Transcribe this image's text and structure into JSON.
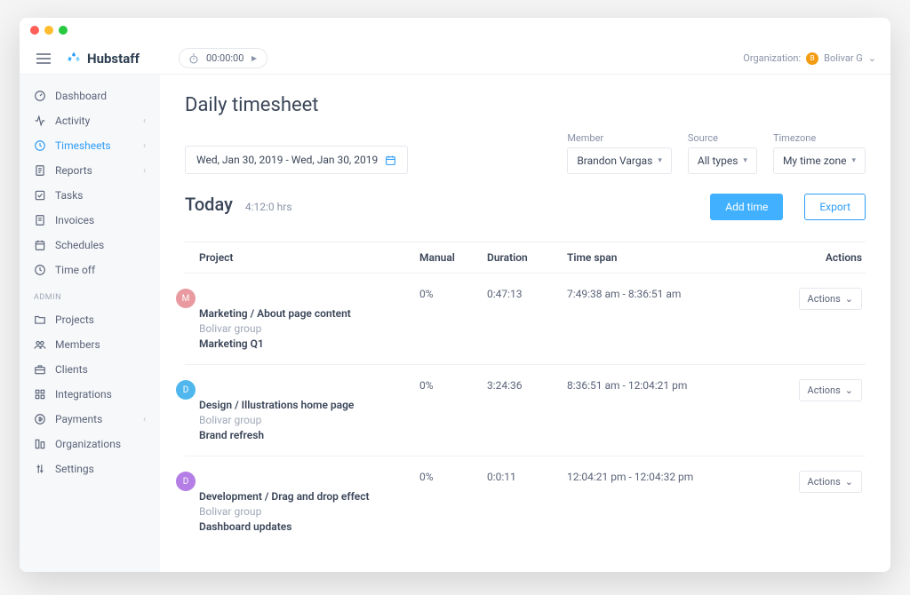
{
  "brand": "Hubstaff",
  "timer": "00:00:00",
  "org_label": "Organization:",
  "user_initial": "B",
  "user_name": "Bolivar G",
  "nav": {
    "items": [
      {
        "label": "Dashboard",
        "icon": "gauge"
      },
      {
        "label": "Activity",
        "icon": "activity",
        "chevron": true
      },
      {
        "label": "Timesheets",
        "icon": "clock",
        "chevron": true,
        "active": true
      },
      {
        "label": "Reports",
        "icon": "report",
        "chevron": true
      },
      {
        "label": "Tasks",
        "icon": "check"
      },
      {
        "label": "Invoices",
        "icon": "invoice"
      },
      {
        "label": "Schedules",
        "icon": "calendar"
      },
      {
        "label": "Time off",
        "icon": "timeoff"
      }
    ],
    "admin_label": "ADMIN",
    "admin_items": [
      {
        "label": "Projects",
        "icon": "folder"
      },
      {
        "label": "Members",
        "icon": "members"
      },
      {
        "label": "Clients",
        "icon": "briefcase"
      },
      {
        "label": "Integrations",
        "icon": "integrations"
      },
      {
        "label": "Payments",
        "icon": "payments",
        "chevron": true
      },
      {
        "label": "Organizations",
        "icon": "org"
      },
      {
        "label": "Settings",
        "icon": "settings"
      }
    ]
  },
  "page": {
    "title": "Daily timesheet",
    "date_range": "Wed, Jan 30, 2019 - Wed, Jan 30, 2019",
    "filters": {
      "member": {
        "label": "Member",
        "value": "Brandon Vargas"
      },
      "source": {
        "label": "Source",
        "value": "All types"
      },
      "timezone": {
        "label": "Timezone",
        "value": "My time zone"
      }
    },
    "today_heading": "Today",
    "today_hrs": "4:12:0 hrs",
    "add_time_btn": "Add time",
    "export_btn": "Export",
    "columns": {
      "project": "Project",
      "manual": "Manual",
      "duration": "Duration",
      "span": "Time span",
      "actions": "Actions"
    },
    "actions_btn": "Actions",
    "rows": [
      {
        "badge": "M",
        "badge_color": "#e89aa0",
        "name": "Marketing / About page content",
        "group": "Bolivar group",
        "task": "Marketing Q1",
        "manual": "0%",
        "duration": "0:47:13",
        "span": "7:49:38 am - 8:36:51 am"
      },
      {
        "badge": "D",
        "badge_color": "#4fb7ed",
        "name": "Design / Illustrations home page",
        "group": "Bolivar group",
        "task": "Brand refresh",
        "manual": "0%",
        "duration": "3:24:36",
        "span": "8:36:51 am - 12:04:21 pm"
      },
      {
        "badge": "D",
        "badge_color": "#b47ee6",
        "name": "Development / Drag and drop effect",
        "group": "Bolivar group",
        "task": "Dashboard updates",
        "manual": "0%",
        "duration": "0:0:11",
        "span": "12:04:21 pm - 12:04:32 pm"
      }
    ]
  }
}
